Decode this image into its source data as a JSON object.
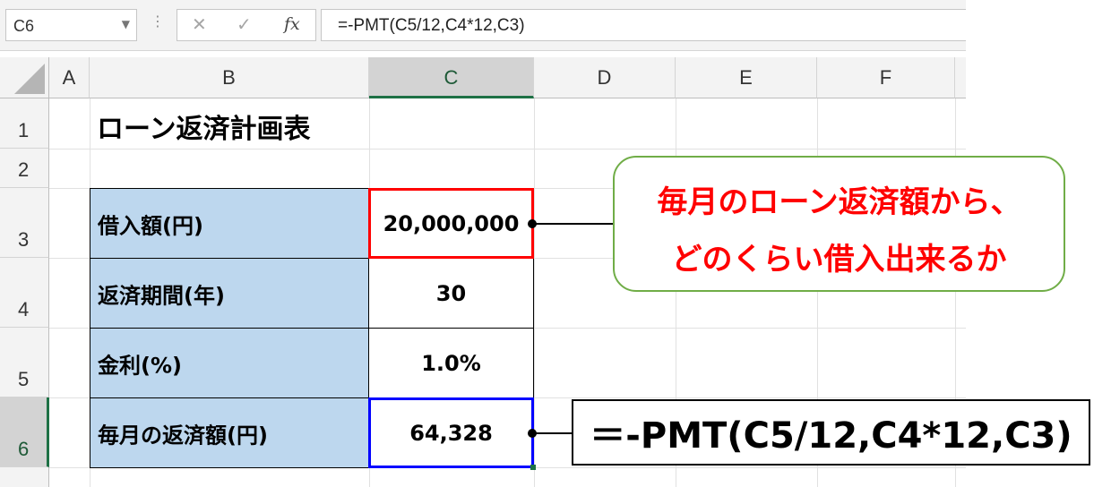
{
  "formula_bar": {
    "name_box": "C6",
    "cancel_glyph": "✕",
    "enter_glyph": "✓",
    "fx_label": "fx",
    "formula": "=-PMT(C5/12,C4*12,C3)"
  },
  "columns": [
    "A",
    "B",
    "C",
    "D",
    "E",
    "F"
  ],
  "selected_column": "C",
  "rows": [
    "1",
    "2",
    "3",
    "4",
    "5",
    "6"
  ],
  "selected_row": "6",
  "sheet": {
    "title": "ローン返済計画表",
    "table": [
      {
        "label": "借入額(円)",
        "value": "20,000,000"
      },
      {
        "label": "返済期間(年)",
        "value": "30"
      },
      {
        "label": "金利(%)",
        "value": "1.0%"
      },
      {
        "label": "毎月の返済額(円)",
        "value": "64,328"
      }
    ]
  },
  "callout": {
    "line1": "毎月のローン返済額から、",
    "line2": "どのくらい借入出来るか",
    "border_color": "#70ad47",
    "text_color": "#ff0000"
  },
  "formula_annotation": "＝-PMT(C5/12,C4*12,C3)",
  "colors": {
    "label_fill": "#bdd7ee",
    "highlight_red": "#ff0000",
    "highlight_blue": "#0000ff",
    "selection_green": "#1e7145"
  }
}
